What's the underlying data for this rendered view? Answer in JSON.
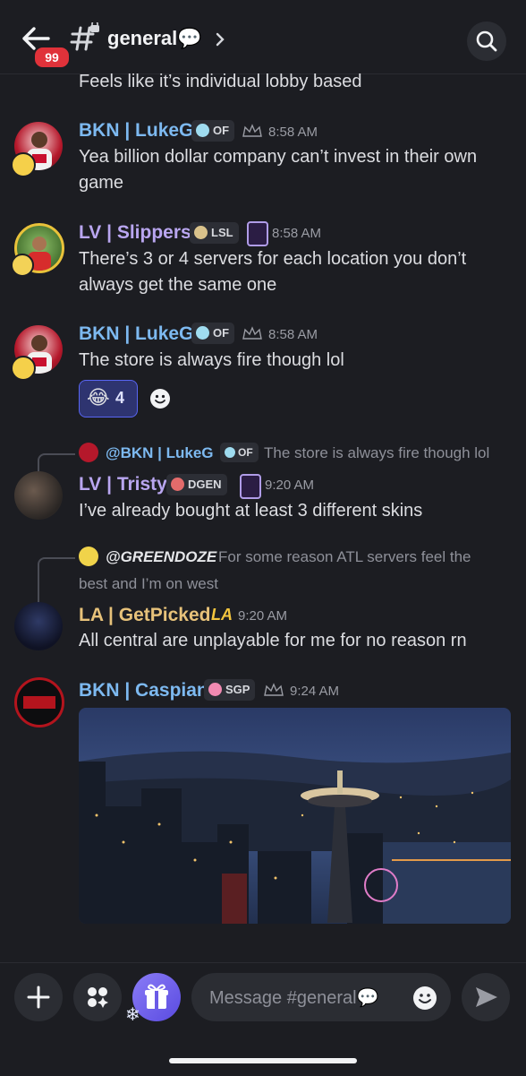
{
  "header": {
    "channel_name": "general💬",
    "unread_badge": "99",
    "icons": [
      "back-arrow-icon",
      "hashtag-lock-icon",
      "chevron-right-icon",
      "search-icon"
    ]
  },
  "messages": [
    {
      "text": "Feels like it’s individual lobby based"
    },
    {
      "author": "BKN | LukeG",
      "author_color": "#7db9f0",
      "tag": "OF",
      "time": "8:58 AM",
      "lines": [
        "Yea billion dollar company can’t invest in their own",
        "game"
      ]
    },
    {
      "author": "LV | Slippers",
      "author_color": "#b9a6f0",
      "tag": "LSL",
      "time": "8:58 AM",
      "lines": [
        "There’s 3 or 4 servers for each location you don’t",
        "always get the same one"
      ]
    },
    {
      "author": "BKN | LukeG",
      "author_color": "#7db9f0",
      "tag": "OF",
      "time": "8:58 AM",
      "lines": [
        "The store is always fire though lol"
      ],
      "reaction": {
        "emoji": "😂",
        "count": "4"
      }
    },
    {
      "reply": {
        "author": "@BKN | LukeG",
        "tag": "OF",
        "text": "The store is always fire though lol"
      },
      "author": "LV | Tristy",
      "author_color": "#b9a6f0",
      "tag": "DGEN",
      "time": "9:20 AM",
      "lines": [
        "I’ve already bought at least 3 different skins"
      ]
    },
    {
      "reply": {
        "author": "@GREENDOZE",
        "text_line1": "For some reason ATL servers feel the",
        "text_line2": "best and I’m on west"
      },
      "author": "LA | GetPicked",
      "author_color": "#e7c27a",
      "time": "9:20 AM",
      "lines": [
        "All central are unplayable for me for no reason rn"
      ]
    },
    {
      "author": "BKN | Caspian",
      "author_color": "#7db9f0",
      "tag": "SGP",
      "time": "9:24 AM",
      "image": "city-skyline-night-space-needle"
    }
  ],
  "composer": {
    "placeholder": "Message #general💬",
    "icons": [
      "plus-icon",
      "apps-icon",
      "gift-icon",
      "emoji-icon",
      "send-icon"
    ]
  },
  "colors": {
    "background": "#1c1d22",
    "accent": "#5865f2",
    "badge": "#e0323a"
  }
}
